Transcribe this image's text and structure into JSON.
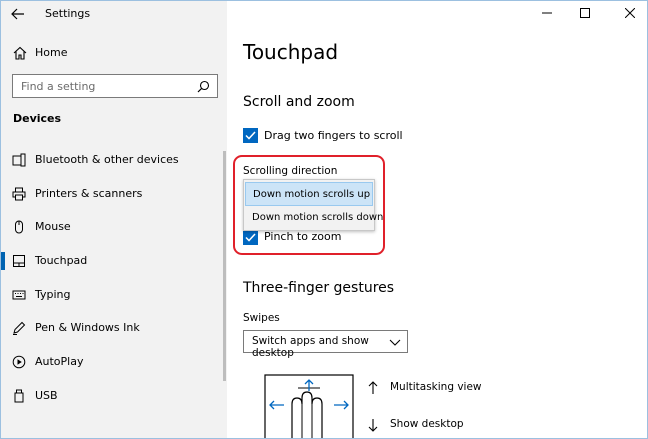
{
  "window": {
    "title": "Settings"
  },
  "sidebar": {
    "home_label": "Home",
    "search_placeholder": "Find a setting",
    "section_title": "Devices",
    "items": [
      {
        "label": "Bluetooth & other devices",
        "icon": "bluetooth-device-icon"
      },
      {
        "label": "Printers & scanners",
        "icon": "printer-icon"
      },
      {
        "label": "Mouse",
        "icon": "mouse-icon"
      },
      {
        "label": "Touchpad",
        "icon": "touchpad-icon",
        "selected": true
      },
      {
        "label": "Typing",
        "icon": "keyboard-icon"
      },
      {
        "label": "Pen & Windows Ink",
        "icon": "pen-icon"
      },
      {
        "label": "AutoPlay",
        "icon": "autoplay-icon"
      },
      {
        "label": "USB",
        "icon": "usb-icon"
      }
    ]
  },
  "main": {
    "title": "Touchpad",
    "scroll_zoom": {
      "heading": "Scroll and zoom",
      "drag_two_fingers": {
        "label": "Drag two fingers to scroll",
        "checked": true
      },
      "scrolling_direction_label": "Scrolling direction",
      "scrolling_direction_options": [
        "Down motion scrolls up",
        "Down motion scrolls down"
      ],
      "scrolling_direction_selected": "Down motion scrolls up",
      "pinch_to_zoom": {
        "label": "Pinch to zoom",
        "checked": true
      }
    },
    "three_finger": {
      "heading": "Three-finger gestures",
      "swipes_label": "Swipes",
      "swipes_value": "Switch apps and show desktop",
      "legend": [
        {
          "arrow": "up",
          "label": "Multitasking view"
        },
        {
          "arrow": "down",
          "label": "Show desktop"
        }
      ]
    }
  },
  "colors": {
    "accent": "#0067c0",
    "selection_highlight": "#cce4f7",
    "annotation_red": "#e0202a",
    "sidebar_bg": "#f2f2f2"
  }
}
